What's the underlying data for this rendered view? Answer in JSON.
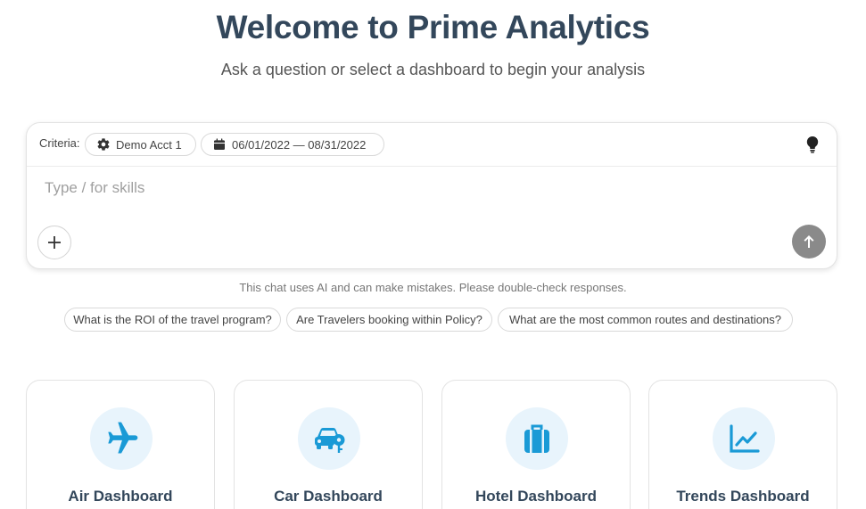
{
  "header": {
    "title": "Welcome to Prime Analytics",
    "subtitle": "Ask a question or select a dashboard to begin your analysis"
  },
  "chat": {
    "criteria_label": "Criteria:",
    "account_chip": "Demo Acct 1",
    "date_chip": "06/01/2022 — 08/31/2022",
    "input_placeholder": "Type / for skills",
    "input_value": "",
    "disclaimer": "This chat uses AI and can make mistakes. Please double-check responses."
  },
  "suggestions": [
    "What is the ROI of the travel program?",
    "Are Travelers booking within Policy?",
    "What are the most common routes and destinations?"
  ],
  "dashboards": [
    {
      "label": "Air Dashboard",
      "icon": "airplane-icon"
    },
    {
      "label": "Car Dashboard",
      "icon": "car-icon"
    },
    {
      "label": "Hotel Dashboard",
      "icon": "luggage-icon"
    },
    {
      "label": "Trends Dashboard",
      "icon": "trend-chart-icon"
    }
  ],
  "colors": {
    "title": "#33475b",
    "accent": "#1a9ad6",
    "icon_bg": "#e8f4fc",
    "send_button": "#8a8a8a"
  }
}
